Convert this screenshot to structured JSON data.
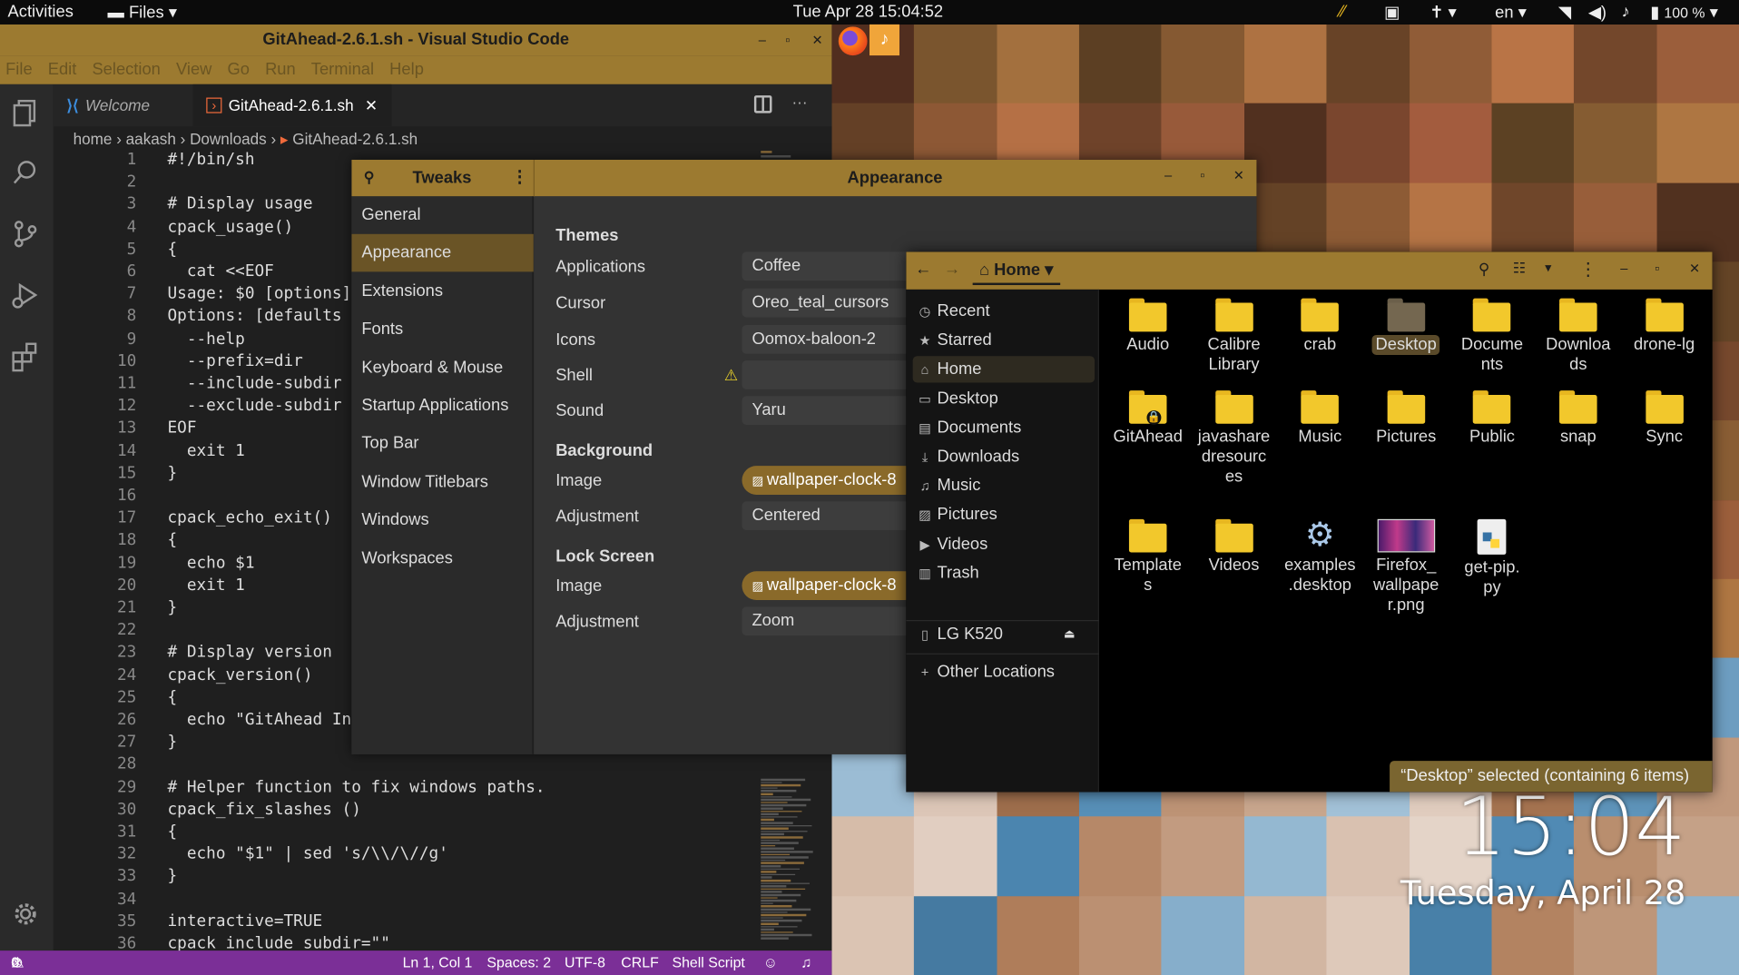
{
  "topbar": {
    "activities": "Activities",
    "files_menu": "Files",
    "datetime": "Tue Apr 28  15:04:52",
    "lang": "en",
    "battery": "100 %"
  },
  "vscode": {
    "title": "GitAhead-2.6.1.sh - Visual Studio Code",
    "menu": [
      "File",
      "Edit",
      "Selection",
      "View",
      "Go",
      "Run",
      "Terminal",
      "Help"
    ],
    "tab_welcome": "Welcome",
    "tab_file": "GitAhead-2.6.1.sh",
    "breadcrumb": [
      "home",
      "aakash",
      "Downloads",
      "GitAhead-2.6.1.sh"
    ],
    "lines": [
      {
        "n": "1",
        "t": "#!/bin/sh",
        "c": "cm"
      },
      {
        "n": "2",
        "t": "",
        "c": ""
      },
      {
        "n": "3",
        "t": "# Display usage",
        "c": "cm"
      },
      {
        "n": "4",
        "t": "cpack_usage()",
        "c": ""
      },
      {
        "n": "5",
        "t": "{",
        "c": ""
      },
      {
        "n": "6",
        "t": "  cat <<EOF",
        "c": ""
      },
      {
        "n": "7",
        "t": "Usage: $0 [options]",
        "c": "kw"
      },
      {
        "n": "8",
        "t": "Options: [defaults",
        "c": "kw"
      },
      {
        "n": "9",
        "t": "  --help",
        "c": "kw"
      },
      {
        "n": "10",
        "t": "  --prefix=dir",
        "c": "kw"
      },
      {
        "n": "11",
        "t": "  --include-subdir",
        "c": "kw"
      },
      {
        "n": "12",
        "t": "  --exclude-subdir",
        "c": "kw"
      },
      {
        "n": "13",
        "t": "EOF",
        "c": "kw"
      },
      {
        "n": "14",
        "t": "  exit 1",
        "c": ""
      },
      {
        "n": "15",
        "t": "}",
        "c": ""
      },
      {
        "n": "16",
        "t": "",
        "c": ""
      },
      {
        "n": "17",
        "t": "cpack_echo_exit()",
        "c": ""
      },
      {
        "n": "18",
        "t": "{",
        "c": ""
      },
      {
        "n": "19",
        "t": "  echo $1",
        "c": ""
      },
      {
        "n": "20",
        "t": "  exit 1",
        "c": ""
      },
      {
        "n": "21",
        "t": "}",
        "c": ""
      },
      {
        "n": "22",
        "t": "",
        "c": ""
      },
      {
        "n": "23",
        "t": "# Display version",
        "c": "cm"
      },
      {
        "n": "24",
        "t": "cpack_version()",
        "c": ""
      },
      {
        "n": "25",
        "t": "{",
        "c": ""
      },
      {
        "n": "26",
        "t": "  echo \"GitAhead In",
        "c": ""
      },
      {
        "n": "27",
        "t": "}",
        "c": ""
      },
      {
        "n": "28",
        "t": "",
        "c": ""
      },
      {
        "n": "29",
        "t": "# Helper function to fix windows paths.",
        "c": "cm"
      },
      {
        "n": "30",
        "t": "cpack_fix_slashes ()",
        "c": ""
      },
      {
        "n": "31",
        "t": "{",
        "c": ""
      },
      {
        "n": "32",
        "t": "  echo \"$1\" | sed 's/\\\\/\\//g'",
        "c": ""
      },
      {
        "n": "33",
        "t": "}",
        "c": ""
      },
      {
        "n": "34",
        "t": "",
        "c": ""
      },
      {
        "n": "35",
        "t": "interactive=TRUE",
        "c": ""
      },
      {
        "n": "36",
        "t": "cpack_include_subdir=\"\"",
        "c": ""
      }
    ],
    "status": {
      "problems": "0",
      "warnings": "0",
      "position": "Ln 1, Col 1",
      "spaces": "Spaces: 2",
      "encoding": "UTF-8",
      "eol": "CRLF",
      "language": "Shell Script"
    }
  },
  "tweaks": {
    "app_title": "Tweaks",
    "panel_title": "Appearance",
    "sidebar": [
      "General",
      "Appearance",
      "Extensions",
      "Fonts",
      "Keyboard & Mouse",
      "Startup Applications",
      "Top Bar",
      "Window Titlebars",
      "Windows",
      "Workspaces"
    ],
    "themes_heading": "Themes",
    "applications_label": "Applications",
    "applications_value": "Coffee",
    "cursor_label": "Cursor",
    "cursor_value": "Oreo_teal_cursors",
    "icons_label": "Icons",
    "icons_value": "Oomox-baloon-2",
    "shell_label": "Shell",
    "shell_value": "",
    "sound_label": "Sound",
    "sound_value": "Yaru",
    "background_heading": "Background",
    "bg_image_label": "Image",
    "bg_image_value": "wallpaper-clock-8",
    "bg_adjust_label": "Adjustment",
    "bg_adjust_value": "Centered",
    "lock_heading": "Lock Screen",
    "lock_image_label": "Image",
    "lock_image_value": "wallpaper-clock-8",
    "lock_adjust_label": "Adjustment",
    "lock_adjust_value": "Zoom"
  },
  "files": {
    "location": "Home",
    "places": [
      "Recent",
      "Starred",
      "Home",
      "Desktop",
      "Documents",
      "Downloads",
      "Music",
      "Pictures",
      "Videos",
      "Trash"
    ],
    "device": "LG K520",
    "other_locations": "Other Locations",
    "items": [
      "Audio",
      "Calibre Library",
      "crab",
      "Desktop",
      "Documents",
      "Downloads",
      "drone-lg",
      "GitAhead",
      "javasharedresources",
      "Music",
      "Pictures",
      "Public",
      "snap",
      "Sync",
      "Templates",
      "Videos",
      "examples.desktop",
      "Firefox_wallpaper.png",
      "get-pip.py"
    ],
    "item_lines": [
      [
        "Audio"
      ],
      [
        "Calibre",
        "Library"
      ],
      [
        "crab"
      ],
      [
        "Desktop"
      ],
      [
        "Docume",
        "nts"
      ],
      [
        "Downloa",
        "ds"
      ],
      [
        "drone-lg"
      ],
      [
        "GitAhead"
      ],
      [
        "javashare",
        "dresourc",
        "es"
      ],
      [
        "Music"
      ],
      [
        "Pictures"
      ],
      [
        "Public"
      ],
      [
        "snap"
      ],
      [
        "Sync"
      ],
      [
        "Template",
        "s"
      ],
      [
        "Videos"
      ],
      [
        "examples",
        ".desktop"
      ],
      [
        "Firefox_",
        "wallpape",
        "r.png"
      ],
      [
        "get-pip.",
        "py"
      ]
    ],
    "status": "“Desktop” selected  (containing 6 items)"
  },
  "desktop_clock": {
    "time": "15:04",
    "date": "Tuesday, April 28"
  },
  "colors": {
    "accent": "#9c7a30",
    "vscode_status": "#7b2f97",
    "folder": "#f2c82c"
  }
}
